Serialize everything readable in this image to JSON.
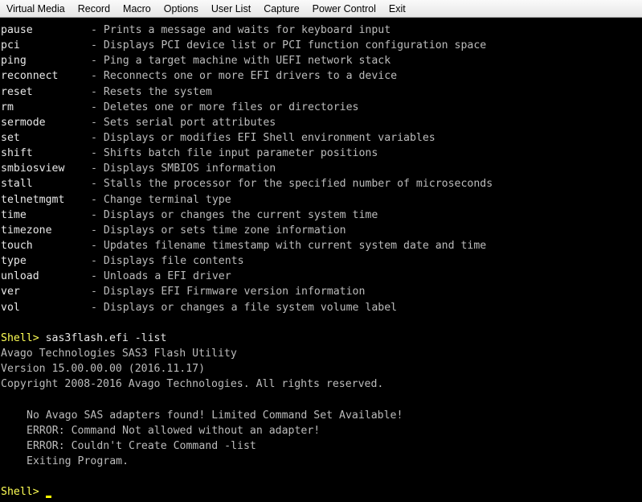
{
  "menubar": {
    "items": [
      {
        "label": "Virtual Media"
      },
      {
        "label": "Record"
      },
      {
        "label": "Macro"
      },
      {
        "label": "Options"
      },
      {
        "label": "User List"
      },
      {
        "label": "Capture"
      },
      {
        "label": "Power Control"
      },
      {
        "label": "Exit"
      }
    ]
  },
  "console": {
    "help_entries": [
      {
        "cmd": "pause",
        "desc": "- Prints a message and waits for keyboard input"
      },
      {
        "cmd": "pci",
        "desc": "- Displays PCI device list or PCI function configuration space"
      },
      {
        "cmd": "ping",
        "desc": "- Ping a target machine with UEFI network stack"
      },
      {
        "cmd": "reconnect",
        "desc": "- Reconnects one or more EFI drivers to a device"
      },
      {
        "cmd": "reset",
        "desc": "- Resets the system"
      },
      {
        "cmd": "rm",
        "desc": "- Deletes one or more files or directories"
      },
      {
        "cmd": "sermode",
        "desc": "- Sets serial port attributes"
      },
      {
        "cmd": "set",
        "desc": "- Displays or modifies EFI Shell environment variables"
      },
      {
        "cmd": "shift",
        "desc": "- Shifts batch file input parameter positions"
      },
      {
        "cmd": "smbiosview",
        "desc": "- Displays SMBIOS information"
      },
      {
        "cmd": "stall",
        "desc": "- Stalls the processor for the specified number of microseconds"
      },
      {
        "cmd": "telnetmgmt",
        "desc": "- Change terminal type"
      },
      {
        "cmd": "time",
        "desc": "- Displays or changes the current system time"
      },
      {
        "cmd": "timezone",
        "desc": "- Displays or sets time zone information"
      },
      {
        "cmd": "touch",
        "desc": "- Updates filename timestamp with current system date and time"
      },
      {
        "cmd": "type",
        "desc": "- Displays file contents"
      },
      {
        "cmd": "unload",
        "desc": "- Unloads a EFI driver"
      },
      {
        "cmd": "ver",
        "desc": "- Displays EFI Firmware version information"
      },
      {
        "cmd": "vol",
        "desc": "- Displays or changes a file system volume label"
      }
    ],
    "prompt": "Shell>",
    "command": " sas3flash.efi -list",
    "output": [
      "Avago Technologies SAS3 Flash Utility",
      "Version 15.00.00.00 (2016.11.17)",
      "Copyright 2008-2016 Avago Technologies. All rights reserved."
    ],
    "messages": [
      "No Avago SAS adapters found! Limited Command Set Available!",
      "ERROR: Command Not allowed without an adapter!",
      "ERROR: Couldn't Create Command -list",
      "Exiting Program."
    ],
    "final_prompt": "Shell>"
  },
  "colors": {
    "background": "#000000",
    "text": "#bcbcbc",
    "prompt": "#ffff55",
    "cursor": "#ffff00"
  }
}
